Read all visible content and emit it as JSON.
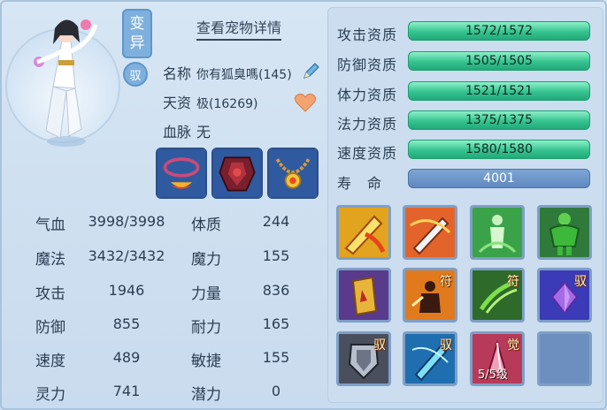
{
  "badges": {
    "transform": "变异",
    "ride": "驭"
  },
  "detail_link": "查看宠物详情",
  "info": {
    "name_label": "名称",
    "name_value": "你有狐臭嗎(145)",
    "talent_label": "天资",
    "talent_value": "极(16269)",
    "blood_label": "血脉",
    "blood_value": "无"
  },
  "stats_left": [
    {
      "label": "气血",
      "value": "3998/3998"
    },
    {
      "label": "魔法",
      "value": "3432/3432"
    },
    {
      "label": "攻击",
      "value": "1946"
    },
    {
      "label": "防御",
      "value": "855"
    },
    {
      "label": "速度",
      "value": "489"
    },
    {
      "label": "灵力",
      "value": "741"
    }
  ],
  "stats_right": [
    {
      "label": "体质",
      "value": "244"
    },
    {
      "label": "魔力",
      "value": "155"
    },
    {
      "label": "力量",
      "value": "836"
    },
    {
      "label": "耐力",
      "value": "165"
    },
    {
      "label": "敏捷",
      "value": "155"
    },
    {
      "label": "潜力",
      "value": "0"
    }
  ],
  "qualities": [
    {
      "label": "攻击资质",
      "value": "1572/1572"
    },
    {
      "label": "防御资质",
      "value": "1505/1505"
    },
    {
      "label": "体力资质",
      "value": "1521/1521"
    },
    {
      "label": "法力资质",
      "value": "1375/1375"
    },
    {
      "label": "速度资质",
      "value": "1580/1580"
    }
  ],
  "life": {
    "label": "寿　命",
    "value": "4001"
  },
  "skills": [
    {
      "icon": "flaming-sword-icon",
      "tag": "",
      "level": ""
    },
    {
      "icon": "sword-slash-icon",
      "tag": "",
      "level": ""
    },
    {
      "icon": "green-figure-icon",
      "tag": "",
      "level": ""
    },
    {
      "icon": "green-giant-icon",
      "tag": "",
      "level": ""
    },
    {
      "icon": "spell-scroll-icon",
      "tag": "",
      "level": ""
    },
    {
      "icon": "shadow-warrior-icon",
      "tag": "符",
      "level": ""
    },
    {
      "icon": "claw-strike-icon",
      "tag": "符",
      "level": ""
    },
    {
      "icon": "purple-gem-icon",
      "tag": "驭",
      "level": ""
    },
    {
      "icon": "armor-shield-icon",
      "tag": "驭",
      "level": ""
    },
    {
      "icon": "blue-dagger-icon",
      "tag": "驭",
      "level": ""
    },
    {
      "icon": "red-crystal-icon",
      "tag": "觉",
      "level": "5/5级"
    },
    {
      "icon": "empty-slot",
      "tag": "",
      "level": ""
    }
  ],
  "colors": {
    "quality_bar": "#35c390",
    "life_bar": "#5f88bf",
    "panel": "#cbddef"
  }
}
